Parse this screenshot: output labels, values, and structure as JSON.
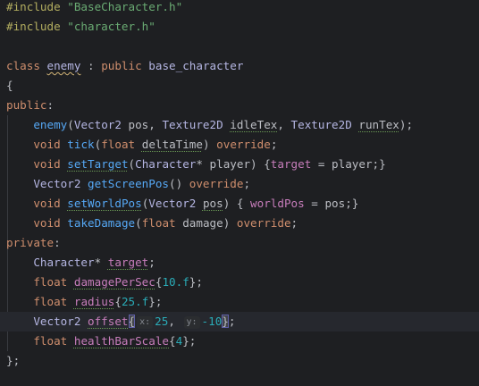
{
  "editor": {
    "language": "C++",
    "theme": {
      "background": "#1e1f22",
      "current_line": "#26282e",
      "keyword": "#cf8e6d",
      "string": "#6aab73",
      "type": "#b5b6e3",
      "function": "#56a8f5",
      "field": "#c77dbb",
      "number": "#2aacb8",
      "macro": "#b3ae60",
      "text": "#bcbec4"
    },
    "current_line_index": 16,
    "lines": [
      [
        {
          "t": "#include",
          "c": "macro"
        },
        {
          "t": " "
        },
        {
          "t": "\"BaseCharacter.h\"",
          "c": "str"
        }
      ],
      [
        {
          "t": "#include",
          "c": "macro"
        },
        {
          "t": " "
        },
        {
          "t": "\"character.h\"",
          "c": "str"
        }
      ],
      [],
      [
        {
          "t": "class",
          "c": "kw"
        },
        {
          "t": " "
        },
        {
          "t": "enemy",
          "c": "type",
          "u": "warn"
        },
        {
          "t": " : "
        },
        {
          "t": "public",
          "c": "kw"
        },
        {
          "t": " "
        },
        {
          "t": "base_character",
          "c": "type"
        }
      ],
      [
        {
          "t": "{"
        }
      ],
      [
        {
          "t": "public",
          "c": "kw"
        },
        {
          "t": ":"
        }
      ],
      [
        {
          "t": "    "
        },
        {
          "t": "enemy",
          "c": "fn"
        },
        {
          "t": "("
        },
        {
          "t": "Vector2",
          "c": "type"
        },
        {
          "t": " pos, "
        },
        {
          "t": "Texture2D",
          "c": "type"
        },
        {
          "t": " "
        },
        {
          "t": "idleTex",
          "u": "typo"
        },
        {
          "t": ", "
        },
        {
          "t": "Texture2D",
          "c": "type"
        },
        {
          "t": " "
        },
        {
          "t": "runTex",
          "u": "typo"
        },
        {
          "t": ");"
        }
      ],
      [
        {
          "t": "    "
        },
        {
          "t": "void",
          "c": "kw"
        },
        {
          "t": " "
        },
        {
          "t": "tick",
          "c": "fn"
        },
        {
          "t": "("
        },
        {
          "t": "float",
          "c": "kw"
        },
        {
          "t": " "
        },
        {
          "t": "deltaTime",
          "u": "typo"
        },
        {
          "t": ") "
        },
        {
          "t": "override",
          "c": "kw"
        },
        {
          "t": ";"
        }
      ],
      [
        {
          "t": "    "
        },
        {
          "t": "void",
          "c": "kw"
        },
        {
          "t": " "
        },
        {
          "t": "setTarget",
          "c": "fn",
          "u": "typo"
        },
        {
          "t": "("
        },
        {
          "t": "Character",
          "c": "type"
        },
        {
          "t": "* player) {"
        },
        {
          "t": "target",
          "c": "field"
        },
        {
          "t": " = player;}"
        }
      ],
      [
        {
          "t": "    "
        },
        {
          "t": "Vector2",
          "c": "type"
        },
        {
          "t": " "
        },
        {
          "t": "getScreenPos",
          "c": "fn"
        },
        {
          "t": "() "
        },
        {
          "t": "override",
          "c": "kw"
        },
        {
          "t": ";"
        }
      ],
      [
        {
          "t": "    "
        },
        {
          "t": "void",
          "c": "kw"
        },
        {
          "t": " "
        },
        {
          "t": "setWorldPos",
          "c": "fn",
          "u": "typo"
        },
        {
          "t": "("
        },
        {
          "t": "Vector2",
          "c": "type"
        },
        {
          "t": " "
        },
        {
          "t": "pos",
          "u": "typo"
        },
        {
          "t": ") { "
        },
        {
          "t": "worldPos",
          "c": "field"
        },
        {
          "t": " = pos;}"
        }
      ],
      [
        {
          "t": "    "
        },
        {
          "t": "void",
          "c": "kw"
        },
        {
          "t": " "
        },
        {
          "t": "takeDamage",
          "c": "fn"
        },
        {
          "t": "("
        },
        {
          "t": "float",
          "c": "kw"
        },
        {
          "t": " damage) "
        },
        {
          "t": "override",
          "c": "kw"
        },
        {
          "t": ";"
        }
      ],
      [
        {
          "t": "private",
          "c": "kw"
        },
        {
          "t": ":"
        }
      ],
      [
        {
          "t": "    "
        },
        {
          "t": "Character",
          "c": "type"
        },
        {
          "t": "* "
        },
        {
          "t": "target",
          "c": "field",
          "u": "typo"
        },
        {
          "t": ";"
        }
      ],
      [
        {
          "t": "    "
        },
        {
          "t": "float",
          "c": "kw"
        },
        {
          "t": " "
        },
        {
          "t": "damagePerSec",
          "c": "field",
          "u": "typo"
        },
        {
          "t": "{"
        },
        {
          "t": "10.f",
          "c": "num"
        },
        {
          "t": "};"
        }
      ],
      [
        {
          "t": "    "
        },
        {
          "t": "float",
          "c": "kw"
        },
        {
          "t": " "
        },
        {
          "t": "radius",
          "c": "field",
          "u": "typo"
        },
        {
          "t": "{"
        },
        {
          "t": "25.f",
          "c": "num"
        },
        {
          "t": "};"
        }
      ],
      [
        {
          "t": "    "
        },
        {
          "t": "Vector2",
          "c": "type"
        },
        {
          "t": " "
        },
        {
          "t": "offset",
          "c": "field",
          "u": "typo"
        },
        {
          "t": "{",
          "b": true
        },
        {
          "h": "x:"
        },
        {
          "t": "25",
          "c": "num"
        },
        {
          "t": ", "
        },
        {
          "h": "y:"
        },
        {
          "t": "-10",
          "c": "num"
        },
        {
          "t": "}",
          "b": true
        },
        {
          "t": ";"
        }
      ],
      [
        {
          "t": "    "
        },
        {
          "t": "float",
          "c": "kw"
        },
        {
          "t": " "
        },
        {
          "t": "healthBarScale",
          "c": "field",
          "u": "typo"
        },
        {
          "t": "{"
        },
        {
          "t": "4",
          "c": "num"
        },
        {
          "t": "};"
        }
      ],
      [
        {
          "t": "};"
        }
      ]
    ]
  }
}
